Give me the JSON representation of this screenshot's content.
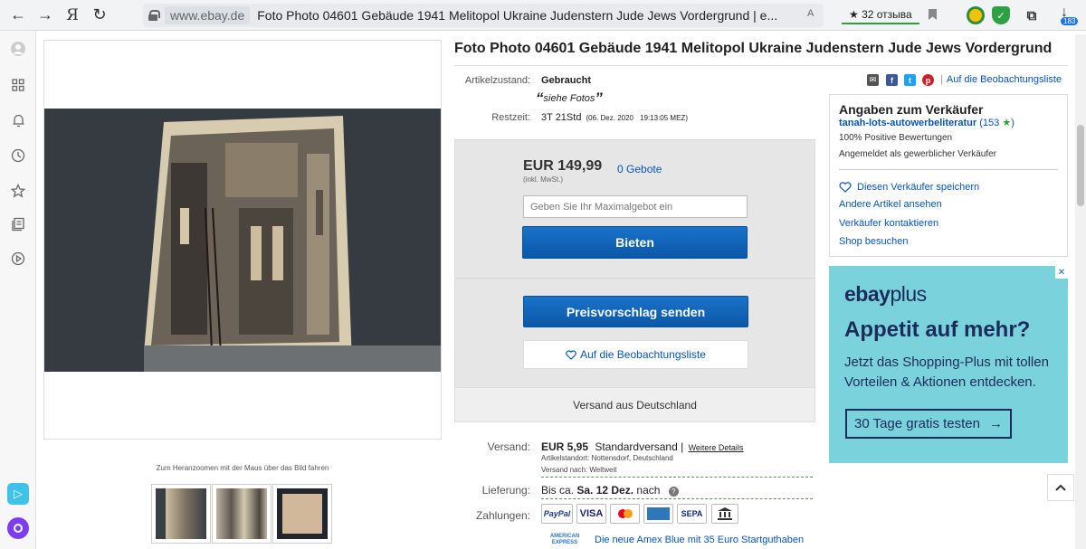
{
  "browser": {
    "back": "←",
    "forward": "→",
    "yandex": "Я",
    "reload": "↻",
    "domain": "www.ebay.de",
    "page_title": "Foto Photo 04601 Gebäude 1941 Melitopol Ukraine Judenstern Jude Jews Vordergrund | e...",
    "translate_icon": "A",
    "reviews_label": "★ 32 отзыва",
    "download_badge": "183"
  },
  "item": {
    "title": "Foto Photo 04601 Gebäude 1941 Melitopol Ukraine Judenstern Jude Jews Vordergrund",
    "condition_label": "Artikelzustand:",
    "condition_value": "Gebraucht",
    "condition_note": "siehe Fotos",
    "time_label": "Restzeit:",
    "time_value": "3T 21Std",
    "time_date": "(06. Dez. 2020",
    "time_clock": "19:13:05 MEZ)",
    "watchlist_link": "Auf die Beobachtungsliste"
  },
  "gallery": {
    "zoom_hint": "Zum Heranzoomen mit der Maus über das Bild fahren"
  },
  "bid": {
    "price": "EUR 149,99",
    "bids": "0 Gebote",
    "vat_note": "(inkl. MwSt.)",
    "input_placeholder": "Geben Sie Ihr Maximalgebot ein",
    "bid_button": "Bieten",
    "offer_button": "Preisvorschlag senden",
    "watch_button": "Auf die Beobachtungsliste",
    "ships_from": "Versand aus Deutschland"
  },
  "seller": {
    "heading": "Angaben zum Verkäufer",
    "name": "tanah-lots-autowerbeliteratur",
    "score": "(153",
    "score_close": ")",
    "positive": "100% Positive Bewertungen",
    "type": "Angemeldet als gewerblicher Verkäufer",
    "save": "Diesen Verkäufer speichern",
    "other_items": "Andere Artikel ansehen",
    "contact": "Verkäufer kontaktieren",
    "shop": "Shop besuchen"
  },
  "ad": {
    "brand_ebay": "ebay",
    "brand_plus": "plus",
    "headline": "Appetit auf mehr?",
    "body": "Jetzt das Shopping-Plus mit tollen Vorteilen & Aktionen entdecken.",
    "cta": "30 Tage gratis testen",
    "close": "✕"
  },
  "shipping": {
    "label": "Versand:",
    "cost": "EUR 5,95",
    "method": "Standardversand |",
    "details_link": "Weitere Details",
    "location": "Artikelstandort:  Nottensdorf, Deutschland",
    "ships_to": "Versand nach:  Weltweit",
    "delivery_label": "Lieferung:",
    "delivery_prefix": "Bis ca.",
    "delivery_date": "Sa. 12 Dez.",
    "delivery_suffix": "nach",
    "payments_label": "Zahlungen:",
    "payments": [
      "PayPal",
      "VISA",
      "MC",
      "AMEX",
      "SEPA",
      "BANK"
    ],
    "amex_logo_top": "AMERICAN",
    "amex_logo_bottom": "EXPRESS",
    "amex_promo": "Die neue Amex Blue mit 35 Euro Startguthaben"
  },
  "colors": {
    "link": "#0654ba",
    "bid_blue": "#0a57a8",
    "ad_bg": "#7ad3dc"
  }
}
